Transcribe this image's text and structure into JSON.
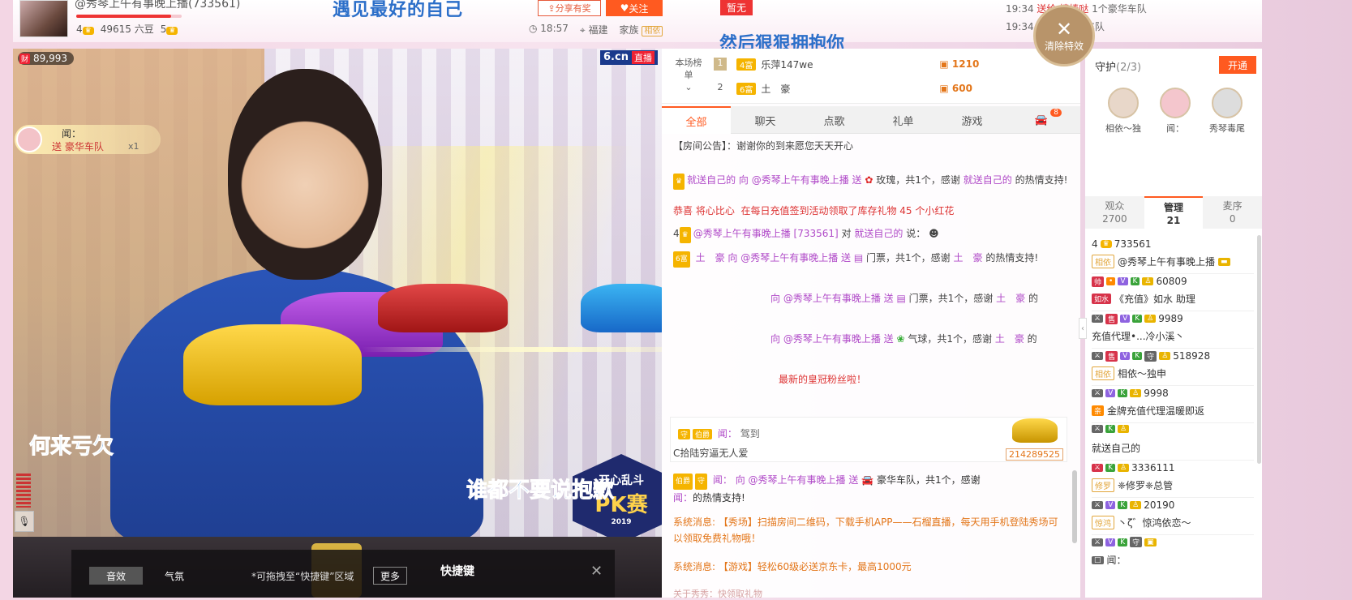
{
  "header": {
    "anchor_name": "@秀琴上午有事晚上播(733561)",
    "anchor_level": "4",
    "beans": "49615 六豆",
    "crowns": "5",
    "banner_top": "遇见最好的自己",
    "share_label": "分享有奖",
    "follow_label": "关注",
    "time": "18:57",
    "location": "福建",
    "family_label": "家族",
    "family_tag": "相依"
  },
  "marquee": {
    "flag": "暂无",
    "banner": "然后狠狠拥抱你",
    "msg1_time": "19:34",
    "msg1_text": "送给",
    "msg1_user": "棒棒哒",
    "msg1_gift": "1个豪华车队",
    "msg2_time": "19:34",
    "msg2_user": "姨",
    "msg2_gift": "1个豪华车队"
  },
  "clear_effects": {
    "icon": "close-icon",
    "label": "清除特效"
  },
  "video": {
    "coin_badge_icon": "财",
    "coin_badge_value": "89,993",
    "brand": "6.cn",
    "live_label": "直播",
    "toast_user": "闻：",
    "toast_text": "送 豪华车队",
    "toast_count": "x1",
    "watermark_left": "何来亏欠",
    "watermark_right": "谁都不要说抱歉",
    "pk_top": "开心乱斗",
    "pk_main": "PK赛",
    "pk_year": "2019"
  },
  "toolbar": {
    "sound_label": "音效",
    "atmosphere_label": "气氛",
    "drag_hint": "*可拖拽至“快捷键”区域",
    "more_label": "更多",
    "quick_title": "快捷键",
    "close_icon": "close-icon"
  },
  "ranking": {
    "label": "本场榜单",
    "rows": [
      {
        "rank": "1",
        "level": "4富",
        "name": "乐萍147we",
        "coins": "1210"
      },
      {
        "rank": "2",
        "level": "6富",
        "name": "土　豪",
        "coins": "600"
      }
    ]
  },
  "tabs": [
    {
      "label": "全部"
    },
    {
      "label": "聊天"
    },
    {
      "label": "点歌"
    },
    {
      "label": "礼单"
    },
    {
      "label": "游戏"
    }
  ],
  "car_tab_badge": "8",
  "chat": {
    "notice": "【房间公告】：谢谢你的到来愿您天天开心",
    "m1_user": "就送自己的",
    "m1_to": "向 @秀琴上午有事晚上播 送",
    "m1_gift": "玫瑰，共1个，感谢",
    "m1_thanks_user": "就送自己的",
    "m1_tail": "的热情支持!",
    "m2_user": "恭喜 将心比心",
    "m2_text": "在每日充值签到活动领取了库存礼物 45 个小红花",
    "m3_level": "4",
    "m3_user": "@秀琴上午有事晚上播 [733561]",
    "m3_to": "对",
    "m3_target": "就送自己的",
    "m3_verb": "说：",
    "m4_user": "土　豪",
    "m4_to": "向 @秀琴上午有事晚上播 送",
    "m4_gift": "门票，共1个，感谢",
    "m4_thanks": "土　豪",
    "m4_tail": "的热情支持!",
    "m5_to": "向 @秀琴上午有事晚上播 送",
    "m5_gift": "门票，共1个，感谢",
    "m5_thanks": "土　豪",
    "m5_tail": "的",
    "m6_to": "向 @秀琴上午有事晚上播 送",
    "m6_gift": "气球，共1个，感谢",
    "m6_thanks": "土　豪",
    "m6_tail": "的",
    "m7_text": "最新的皇冠粉丝啦！",
    "car_notice_user": "闻：",
    "car_notice_text": "驾到",
    "car_notice_sub": "C拾陆穷逼无人爱",
    "car_notice_id": "214289525",
    "m8_user": "闻：",
    "m8_to": "向 @秀琴上午有事晚上播 送",
    "m8_gift": "豪华车队，共1个，感谢",
    "m8_thanks": "闻：",
    "m8_tail": "的热情支持!",
    "sys1": "系统消息: 【秀场】扫描房间二维码，下载手机APP——石榴直播，每天用手机登陆秀场可以领取免费礼物哦！",
    "sys2": "系统消息: 【游戏】轻松60级必送京东卡，最高1000元",
    "bottom_faint": "关于秀秀：快领取礼物"
  },
  "guard": {
    "title": "守护",
    "count": "(2/3)",
    "open_label": "开通",
    "members": [
      {
        "name": "相依～独"
      },
      {
        "name": "闻："
      },
      {
        "name": "秀琴毒尾"
      }
    ]
  },
  "sub_tabs": [
    {
      "label": "观众",
      "count": "2700"
    },
    {
      "label": "管理",
      "count": "21"
    },
    {
      "label": "麦序",
      "count": "0"
    }
  ],
  "users": [
    {
      "id": "733561",
      "name": "@秀琴上午有事晚上播",
      "tag": "相依"
    },
    {
      "id": "60809",
      "name": "《充值》如水   助理",
      "tag": "如水"
    },
    {
      "id": "9989",
      "name": "充值代理•...冷小溪丶",
      "tag": ""
    },
    {
      "id": "518928",
      "name": "相依～独申",
      "tag": "相依"
    },
    {
      "id": "9998",
      "name": "金牌充值代理温暖即返",
      "tag": "亲"
    },
    {
      "id": "",
      "name": "就送自己的",
      "tag": ""
    },
    {
      "id": "3336111",
      "name": "❈修罗❈总管",
      "tag": "修罗"
    },
    {
      "id": "20190",
      "name": "丶ζ゛惊鸿依恋～",
      "tag": "惊鸿"
    },
    {
      "id": "",
      "name": "闻：",
      "tag": ""
    }
  ]
}
